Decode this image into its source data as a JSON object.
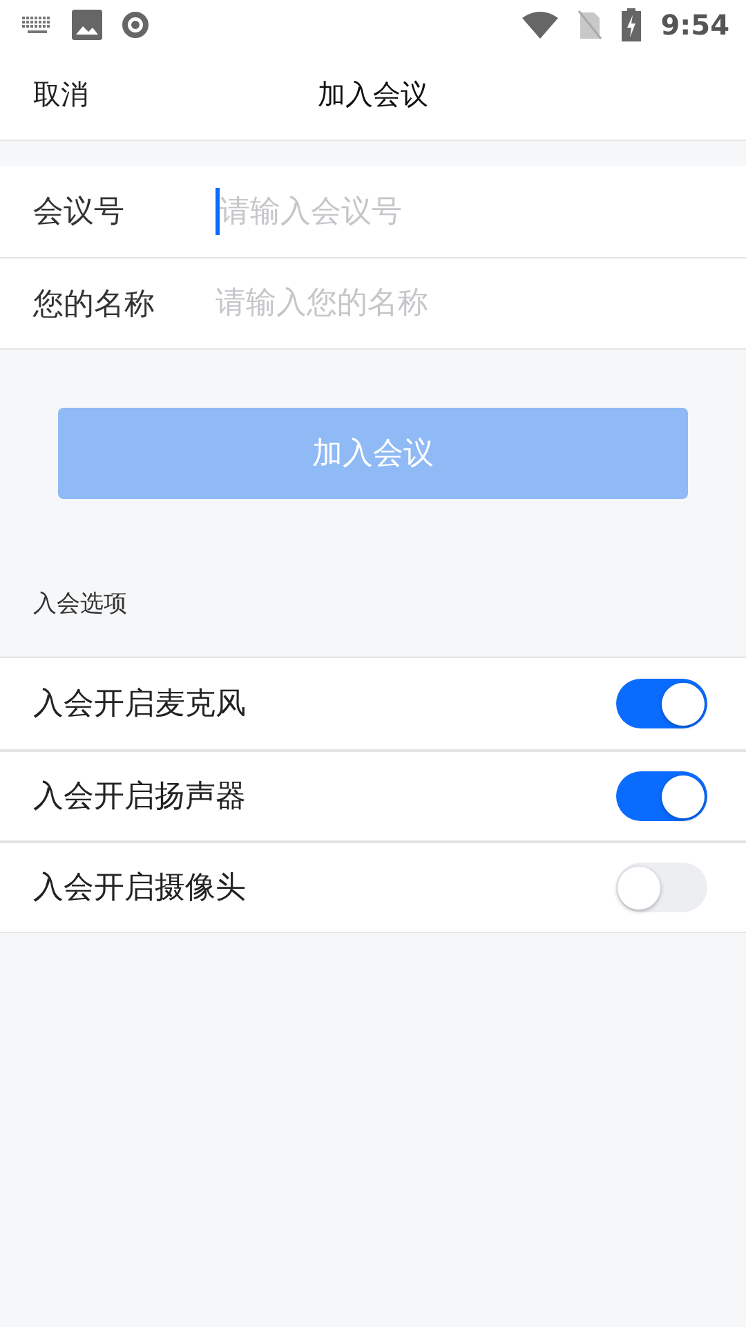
{
  "status_bar": {
    "time": "9:54"
  },
  "header": {
    "cancel": "取消",
    "title": "加入会议"
  },
  "fields": [
    {
      "label": "会议号",
      "placeholder": "请输入会议号",
      "focused": true
    },
    {
      "label": "您的名称",
      "placeholder": "请输入您的名称",
      "focused": false
    }
  ],
  "join_button": {
    "label": "加入会议",
    "disabled": true
  },
  "options_title": "入会选项",
  "options": [
    {
      "label": "入会开启麦克风",
      "on": true
    },
    {
      "label": "入会开启扬声器",
      "on": true
    },
    {
      "label": "入会开启摄像头",
      "on": false
    }
  ]
}
